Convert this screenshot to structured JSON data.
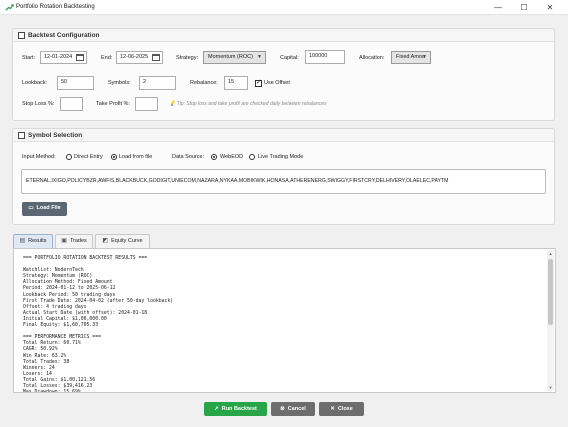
{
  "window": {
    "title": "Portfolio Rotation Backtesting",
    "controls": {
      "minimize": "—",
      "maximize": "☐",
      "close": "✕"
    }
  },
  "config": {
    "section_title": "Backtest Configuration",
    "start_label": "Start:",
    "start_value": "12-01-2024",
    "end_label": "End:",
    "end_value": "12-06-2025",
    "strategy_label": "Strategy:",
    "strategy_value": "Momentum (ROC)",
    "capital_label": "Capital:",
    "capital_value": "100000",
    "allocation_label": "Allocation:",
    "allocation_value": "Fixed Amou",
    "lookback_label": "Lookback:",
    "lookback_value": "50",
    "symbols_label": "Symbols:",
    "symbols_value": "2",
    "rebalance_label": "Rebalance:",
    "rebalance_value": "15",
    "use_offset_label": "Use Offset",
    "use_offset_checked": true,
    "stop_loss_label": "Stop Loss %:",
    "stop_loss_value": "",
    "take_profit_label": "Take Profit %:",
    "take_profit_value": "",
    "tip": "💡 Tip: Stop loss and take profit are checked daily between rebalances"
  },
  "symbol_selection": {
    "section_title": "Symbol Selection",
    "input_method_label": "Input Method:",
    "direct_entry_label": "Direct Entry",
    "load_from_file_label": "Load from file",
    "selected_input_method": "Load from file",
    "data_source_label": "Data Source:",
    "webeod_label": "WebEOD",
    "live_trading_label": "Live Trading Mode",
    "selected_data_source": "WebEOD",
    "symbols_text": "ETERNAL,IXIGO,POLICYBZR,AWFIS,BLACKBUCK,GODIGIT,UNIECOM,NAZARA,NYKAA,MOBIKWIK,HONASA,ATHERENERG,SWIGGY,FIRSTCRY,DELHIVERY,OLAELEC,PAYTM",
    "load_file_label": "Load File"
  },
  "tabs": [
    {
      "label": "Results",
      "active": true
    },
    {
      "label": "Trades",
      "active": false
    },
    {
      "label": "Equity Curve",
      "active": false
    }
  ],
  "results": {
    "lines": [
      "=== PORTFOLIO ROTATION BACKTEST RESULTS ===",
      "",
      "Watchlist: NodernTech",
      "Strategy: Momentum (ROC)",
      "Allocation Method: Fixed Amount",
      "Period: 2024-01-12 to 2025-06-12",
      "Lookback Period: 50 trading days",
      "First Trade Date: 2024-04-02 (after 50-day lookback)",
      "Offset: 4 trading days",
      "Actual Start Date (with offset): 2024-01-18",
      "Initial Capital: $1,00,000.00",
      "Final Equity: $1,60,705.33",
      "",
      "=== PERFORMANCE METRICS ===",
      "Total Return: 60.71%",
      "CAGR: 50.92%",
      "Win Rate: 63.2%",
      "Total Trades: 38",
      "Winners: 24",
      "Losers: 14",
      "Total Gains: $1,00,121.56",
      "Total Losses: $39,416.23",
      "Max Drawdown: 15.69%"
    ]
  },
  "footer": {
    "run_label": "Run Backtest",
    "cancel_label": "Cancel",
    "close_label": "Close"
  },
  "colors": {
    "run_button": "#27a548",
    "cancel_button": "#6d6d6d",
    "close_button": "#6d6d6d",
    "load_file_button": "#5b6874"
  }
}
